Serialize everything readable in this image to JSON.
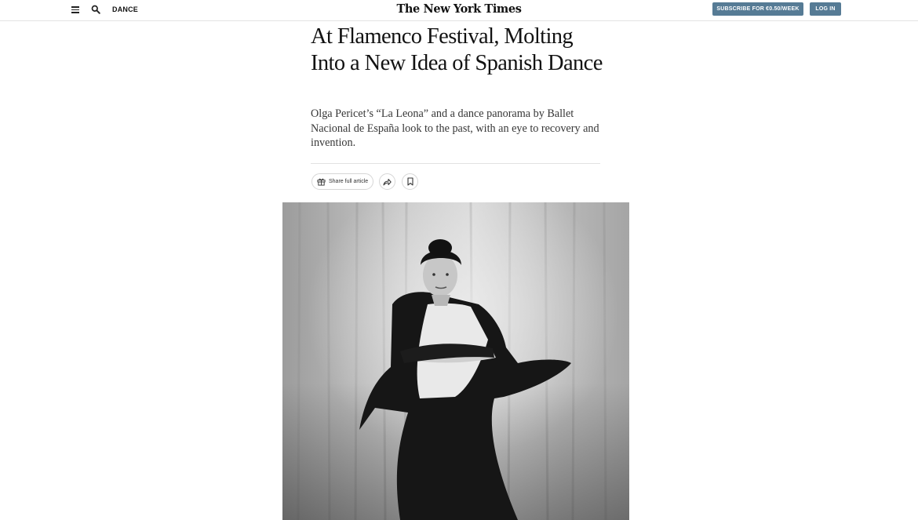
{
  "header": {
    "section": "DANCE",
    "logo": "The New York Times",
    "subscribe_label": "SUBSCRIBE FOR €0.50/WEEK",
    "login_label": "LOG IN"
  },
  "article": {
    "headline": "At Flamenco Festival, Molting Into a New Idea of Spanish Dance",
    "summary": "Olga Pericet’s “La Leona” and a dance panorama by Ballet Nacional de España look to the past, with an eye to recovery and invention.",
    "share_label": "Share full article"
  },
  "icons": {
    "menu": "hamburger-menu-icon",
    "search": "search-icon",
    "gift": "gift-icon",
    "forward": "share-arrow-icon",
    "bookmark": "bookmark-icon"
  },
  "colors": {
    "button_bg": "#567b95",
    "text": "#121212"
  }
}
